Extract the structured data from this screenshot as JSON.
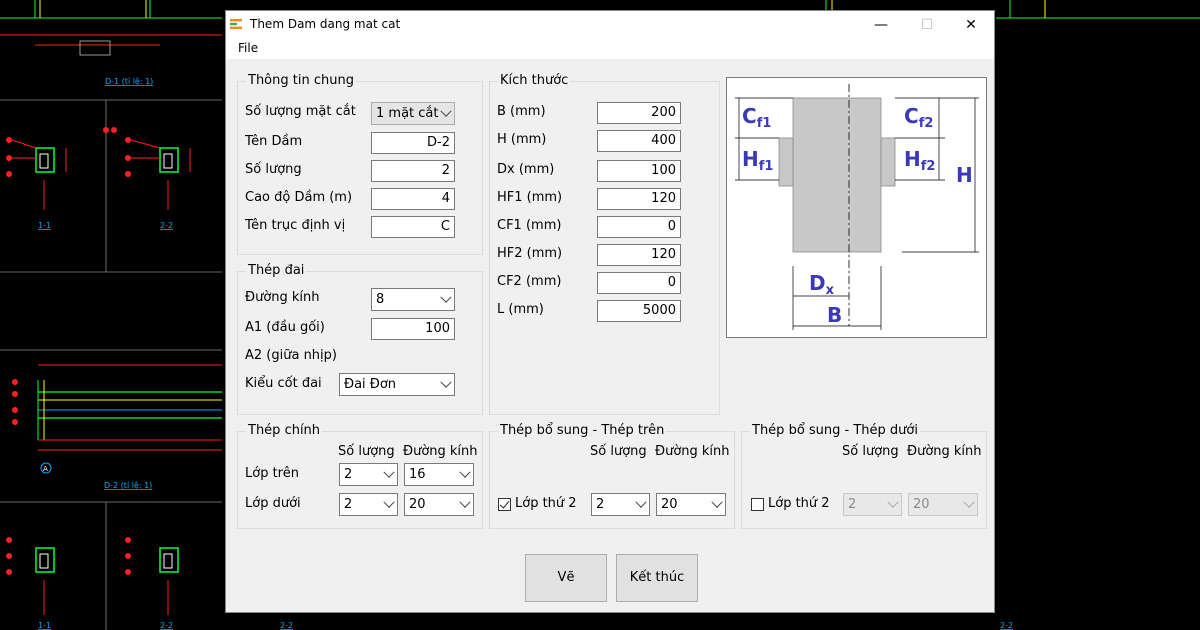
{
  "window": {
    "title": "Them Dam dang mat cat",
    "minimize_glyph": "—",
    "maximize_glyph": "☐",
    "close_glyph": "✕"
  },
  "menu": {
    "file": "File"
  },
  "general": {
    "title": "Thông tin chung",
    "section_count_label": "Số lượng mặt cắt",
    "section_count_value": "1 mặt cắt",
    "beam_name_label": "Tên Dầm",
    "beam_name_value": "D-2",
    "quantity_label": "Số lượng",
    "quantity_value": "2",
    "elevation_label": "Cao độ Dầm (m)",
    "elevation_value": "4",
    "axis_label": "Tên trục định vị",
    "axis_value": "C"
  },
  "dimensions": {
    "title": "Kích thước",
    "rows": [
      {
        "label": "B (mm)",
        "value": "200"
      },
      {
        "label": "H (mm)",
        "value": "400"
      },
      {
        "label": "Dx (mm)",
        "value": "100"
      },
      {
        "label": "HF1 (mm)",
        "value": "120"
      },
      {
        "label": "CF1 (mm)",
        "value": "0"
      },
      {
        "label": "HF2 (mm)",
        "value": "120"
      },
      {
        "label": "CF2 (mm)",
        "value": "0"
      },
      {
        "label": "L (mm)",
        "value": "5000"
      }
    ]
  },
  "stirrup": {
    "title": "Thép đai",
    "diameter_label": "Đường kính",
    "diameter_value": "8",
    "a1_label": "A1 (đầu gối)",
    "a1_value": "100",
    "a2_label": "A2 (giữa nhịp)",
    "type_label": "Kiểu cốt đai",
    "type_value": "Đai Đơn"
  },
  "main_steel": {
    "title": "Thép chính",
    "col_count": "Số lượng",
    "col_diameter": "Đường kính",
    "top_label": "Lớp trên",
    "top_count": "2",
    "top_diameter": "16",
    "bottom_label": "Lớp dưới",
    "bottom_count": "2",
    "bottom_diameter": "20"
  },
  "extra_top": {
    "title": "Thép bổ sung - Thép trên",
    "col_count": "Số lượng",
    "col_diameter": "Đường kính",
    "layer2_label": "Lớp thứ 2",
    "layer2_checked": true,
    "count": "2",
    "diameter": "20"
  },
  "extra_bottom": {
    "title": "Thép bổ sung - Thép dưới",
    "col_count": "Số lượng",
    "col_diameter": "Đường kính",
    "layer2_label": "Lớp thứ 2",
    "layer2_checked": false,
    "count": "2",
    "diameter": "20"
  },
  "buttons": {
    "draw": "Vẽ",
    "finish": "Kết thúc"
  },
  "diagram": {
    "cf1": "C",
    "cf1_sub": "f1",
    "hf1": "H",
    "hf1_sub": "f1",
    "cf2": "C",
    "cf2_sub": "f2",
    "hf2": "H",
    "hf2_sub": "f2",
    "h": "H",
    "dx": "D",
    "dx_sub": "x",
    "b": "B"
  },
  "background_cad": {
    "labels": [
      "D-1 (tỉ lệ: 1)",
      "1-1",
      "2-2",
      "D-2 (tỉ lệ: 1)",
      "1-1",
      "2-2",
      "2-2"
    ],
    "axis_marks": [
      "A"
    ]
  },
  "colors": {
    "label_blue": "#3a3ab8",
    "cad_blue": "#00a8ff",
    "cad_green": "#00ff40",
    "cad_red": "#ff2020",
    "cad_yellow": "#ffff00"
  }
}
